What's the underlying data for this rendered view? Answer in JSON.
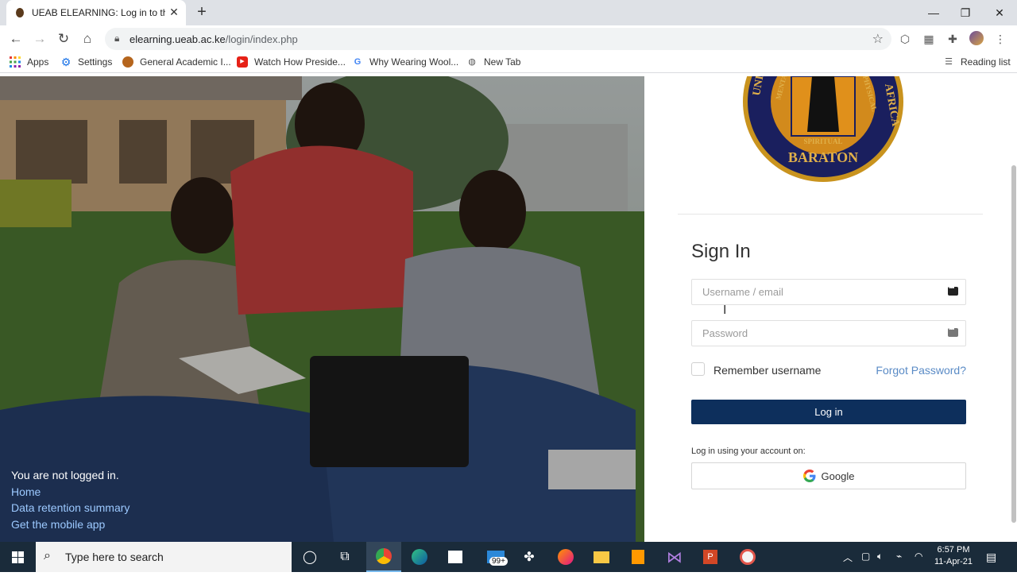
{
  "browser": {
    "tab_title": "UEAB ELEARNING: Log in to the site",
    "url_host": "elearning.ueab.ac.ke",
    "url_path": "/login/index.php",
    "window_controls": [
      "minimize",
      "restore",
      "close"
    ]
  },
  "bookmarks": {
    "items": [
      {
        "label": "Apps",
        "icon": "apps-grid-icon"
      },
      {
        "label": "Settings",
        "icon": "gear-icon"
      },
      {
        "label": "General Academic I...",
        "icon": "ueab-favicon"
      },
      {
        "label": "Watch How Preside...",
        "icon": "youtube-icon"
      },
      {
        "label": "Why Wearing Wool...",
        "icon": "google-icon"
      },
      {
        "label": "New Tab",
        "icon": "globe-icon"
      }
    ],
    "reading_list": "Reading list"
  },
  "hero": {
    "status_text": "You are not logged in.",
    "links": [
      "Home",
      "Data retention summary",
      "Get the mobile app"
    ]
  },
  "login": {
    "title": "Sign In",
    "username_placeholder": "Username / email",
    "password_placeholder": "Password",
    "remember_label": "Remember username",
    "forgot_label": "Forgot Password?",
    "login_button": "Log in",
    "sso_label": "Log in using your account on:",
    "google_button": "Google",
    "logo": {
      "lettering": [
        "UNIVERSITY OF EASTERN AFRICA",
        "BARATON",
        "MENTAL",
        "PHYSICAL",
        "SPIRITUAL"
      ]
    }
  },
  "taskbar": {
    "search_placeholder": "Type here to search",
    "mail_badge": "99+",
    "time": "6:57 PM",
    "date": "11-Apr-21"
  },
  "colors": {
    "primary_button": "#0d2f5c",
    "link": "#5a8bc6",
    "hero_link": "#9cc9ff",
    "taskbar": "#1a2b3a"
  }
}
